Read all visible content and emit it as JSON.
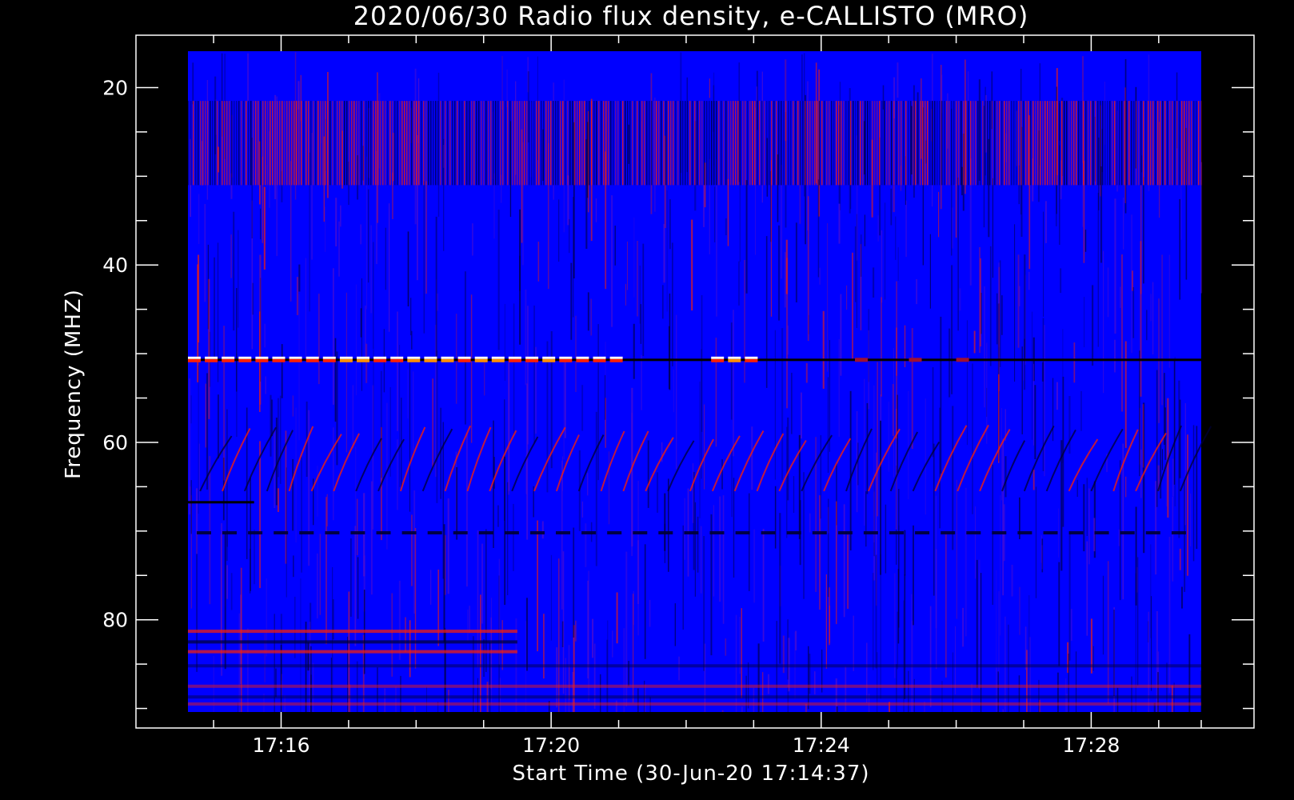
{
  "chart_data": {
    "type": "heatmap",
    "title": "2020/06/30  Radio flux density, e-CALLISTO (MRO)",
    "xlabel": "Start Time (30-Jun-20 17:14:37)",
    "ylabel": "Frequency (MHZ)",
    "x_ticks": [
      {
        "minute": 16.0,
        "label": "17:16"
      },
      {
        "minute": 20.0,
        "label": "17:20"
      },
      {
        "minute": 24.0,
        "label": "17:24"
      },
      {
        "minute": 28.0,
        "label": "17:28"
      }
    ],
    "y_ticks": [
      {
        "value": 20,
        "label": "20"
      },
      {
        "value": 40,
        "label": "40"
      },
      {
        "value": 60,
        "label": "60"
      },
      {
        "value": 80,
        "label": "80"
      }
    ],
    "data_range": {
      "time_start_minute": 14.62,
      "time_end_minute": 29.63,
      "freq_top_mhz": 15.9,
      "freq_bottom_mhz": 90.4
    },
    "interference_line_mhz": 50.7,
    "colormap": {
      "background": "#0000ff",
      "dark": "#000033",
      "red": "#ff2000",
      "orange": "#ff9000",
      "yellow": "#ffff60",
      "white": "#ffffff"
    }
  }
}
